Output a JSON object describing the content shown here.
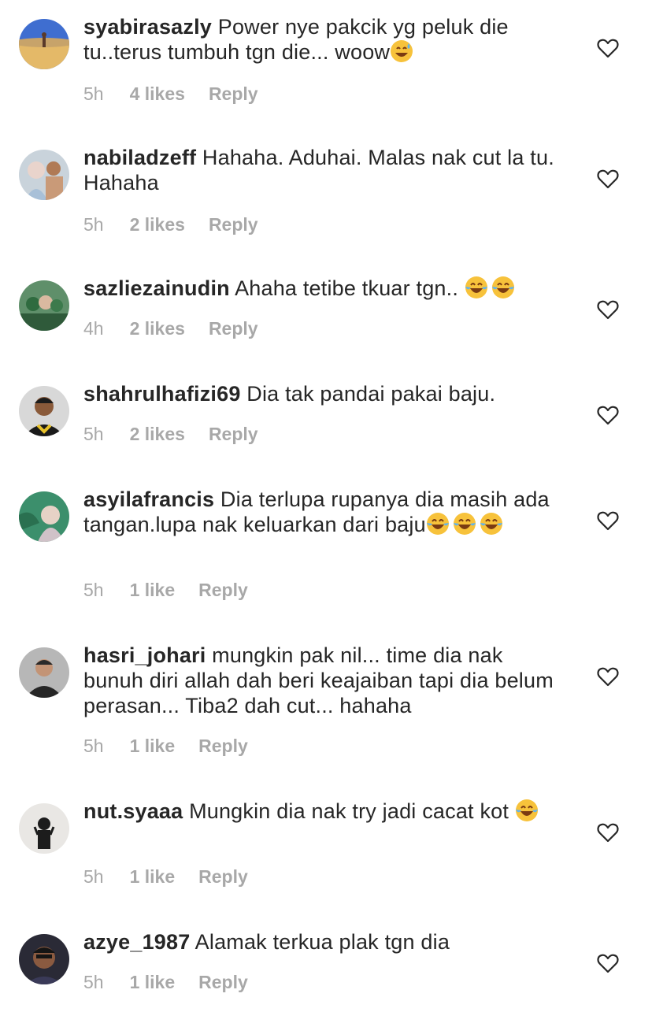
{
  "comments": [
    {
      "username": "syabirasazly",
      "text": "Power nye pakcik yg peluk die tu..terus tumbuh tgn die... woow",
      "emoji_after": [
        "sweat-smile-emoji"
      ],
      "time": "5h",
      "likes": "4 likes",
      "reply": "Reply"
    },
    {
      "username": "nabiladzeff",
      "text": "Hahaha. Aduhai. Malas nak cut la tu. Hahaha",
      "emoji_after": [],
      "time": "5h",
      "likes": "2 likes",
      "reply": "Reply"
    },
    {
      "username": "sazliezainudin",
      "text": "Ahaha tetibe tkuar tgn..",
      "emoji_after": [
        "tears-of-joy-emoji",
        "tears-of-joy-emoji"
      ],
      "time": "4h",
      "likes": "2 likes",
      "reply": "Reply"
    },
    {
      "username": "shahrulhafizi69",
      "text": "Dia tak pandai pakai baju.",
      "emoji_after": [],
      "time": "5h",
      "likes": "2 likes",
      "reply": "Reply"
    },
    {
      "username": "asyilafrancis",
      "text": "Dia terlupa rupanya dia masih ada tangan.lupa nak keluarkan dari baju",
      "emoji_after": [
        "tears-of-joy-emoji",
        "tears-of-joy-emoji",
        "tears-of-joy-emoji"
      ],
      "time": "5h",
      "likes": "1 like",
      "reply": "Reply"
    },
    {
      "username": "hasri_johari",
      "text": "mungkin pak nil... time dia nak bunuh diri allah dah beri keajaiban tapi dia belum perasan... Tiba2 dah cut... hahaha",
      "emoji_after": [],
      "time": "5h",
      "likes": "1 like",
      "reply": "Reply"
    },
    {
      "username": "nut.syaaa",
      "text": "Mungkin dia nak try jadi cacat kot",
      "emoji_after": [
        "tears-of-joy-emoji"
      ],
      "time": "5h",
      "likes": "1 like",
      "reply": "Reply"
    },
    {
      "username": "azye_1987",
      "text": "Alamak terkua plak tgn dia",
      "emoji_after": [],
      "time": "5h",
      "likes": "1 like",
      "reply": "Reply"
    }
  ],
  "icons": {
    "like": "heart-outline-icon"
  },
  "colors": {
    "text": "#262626",
    "meta": "#a8a8a8"
  }
}
